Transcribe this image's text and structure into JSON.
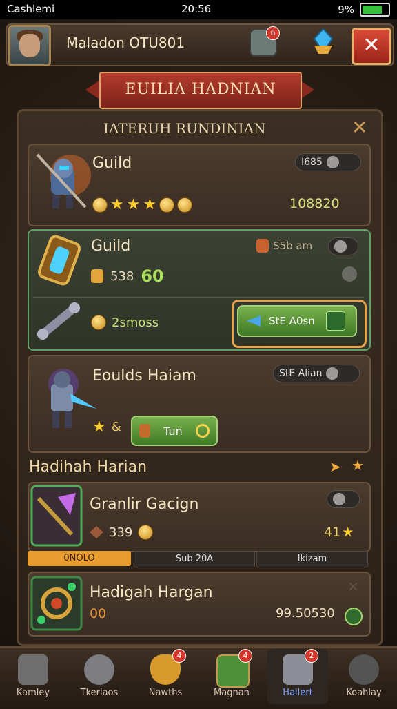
{
  "status_bar": {
    "carrier": "Cashlemi",
    "time": "20:56",
    "battery": "9%"
  },
  "header": {
    "player_name": "Maladon OTU801",
    "currency_badge_count": "6",
    "close_label": "✕"
  },
  "banner": {
    "title": "EUILIA HADNIAN"
  },
  "panel": {
    "title": "IATERUH RUNDINIAN",
    "close_label": "✕"
  },
  "cards": [
    {
      "title": "Guild",
      "chip": "I685",
      "value": "108820",
      "stars": 3
    },
    {
      "title": "Guild",
      "time": "S5b am",
      "cost": "538",
      "cost_highlight": "60",
      "reward": "2smoss",
      "action": "StE A0sn"
    },
    {
      "title": "Eoulds Haiam",
      "chip": "StE Alian",
      "button": "Tun"
    }
  ],
  "section": {
    "title": "Hadihah Harian"
  },
  "daily": [
    {
      "title": "Granlir Gacign",
      "cost": "339",
      "reward": "41"
    },
    {
      "title": "Hadigah Hargan",
      "cost": "00",
      "reward": "99.50530"
    }
  ],
  "progress_tabs": [
    "0NOLO",
    "Sub 20A",
    "Ikizam"
  ],
  "bottom_nav": [
    {
      "label": "Kamley",
      "badge": ""
    },
    {
      "label": "Tkeriaos",
      "badge": ""
    },
    {
      "label": "Nawths",
      "badge": "4"
    },
    {
      "label": "Magnan",
      "badge": "4"
    },
    {
      "label": "Hailert",
      "badge": "2"
    },
    {
      "label": "Koahlay",
      "badge": ""
    }
  ],
  "colors": {
    "accent_red": "#b33c2c",
    "accent_green": "#5ea165",
    "accent_gold": "#e8a248"
  }
}
